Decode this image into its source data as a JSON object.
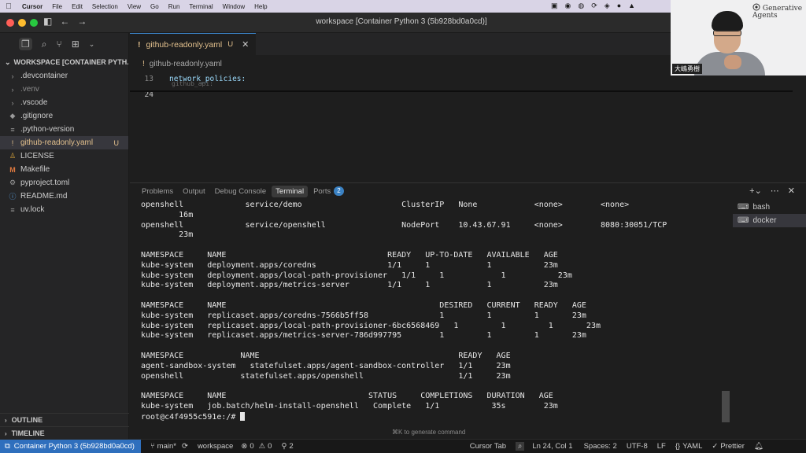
{
  "menubar": {
    "items": [
      "Cursor",
      "File",
      "Edit",
      "Selection",
      "View",
      "Go",
      "Run",
      "Terminal",
      "Window",
      "Help"
    ]
  },
  "window": {
    "title": "workspace [Container Python 3 (5b928bd0a0cd)]"
  },
  "sidebar": {
    "header": "WORKSPACE [CONTAINER PYTH...",
    "items": [
      {
        "label": ".devcontainer",
        "icon": "chevron-right-icon"
      },
      {
        "label": ".venv",
        "icon": "chevron-right-icon"
      },
      {
        "label": ".vscode",
        "icon": "chevron-right-icon"
      },
      {
        "label": ".gitignore",
        "icon": "git-icon"
      },
      {
        "label": ".python-version",
        "icon": "lines-icon"
      },
      {
        "label": "github-readonly.yaml",
        "icon": "exclamation-icon",
        "badge": "U"
      },
      {
        "label": "LICENSE",
        "icon": "license-icon"
      },
      {
        "label": "Makefile",
        "icon": "makefile-icon"
      },
      {
        "label": "pyproject.toml",
        "icon": "gear-icon"
      },
      {
        "label": "README.md",
        "icon": "info-icon"
      },
      {
        "label": "uv.lock",
        "icon": "lines-icon"
      }
    ],
    "outline": "OUTLINE",
    "timeline": "TIMELINE"
  },
  "editor": {
    "tab": {
      "label": "github-readonly.yaml",
      "status": "U"
    },
    "breadcrumb": "github-readonly.yaml",
    "lines": [
      {
        "number": "13",
        "text": "network_policies:"
      },
      {
        "number": "24",
        "text": ""
      }
    ],
    "ghost_text": "github_api:"
  },
  "panel": {
    "tabs": [
      "Problems",
      "Output",
      "Debug Console",
      "Terminal",
      "Ports"
    ],
    "ports_count": "2",
    "terminal_lines": [
      "openshell             service/demo                     ClusterIP   None            <none>        <none>",
      "        16m",
      "openshell             service/openshell                NodePort    10.43.67.91     <none>        8080:30051/TCP",
      "        23m",
      "",
      "NAMESPACE     NAME                                  READY   UP-TO-DATE   AVAILABLE   AGE",
      "kube-system   deployment.apps/coredns               1/1     1            1           23m",
      "kube-system   deployment.apps/local-path-provisioner   1/1     1            1           23m",
      "kube-system   deployment.apps/metrics-server        1/1     1            1           23m",
      "",
      "NAMESPACE     NAME                                             DESIRED   CURRENT   READY   AGE",
      "kube-system   replicaset.apps/coredns-7566b5ff58               1         1         1       23m",
      "kube-system   replicaset.apps/local-path-provisioner-6bc6568469   1         1         1       23m",
      "kube-system   replicaset.apps/metrics-server-786d997795        1         1         1       23m",
      "",
      "NAMESPACE            NAME                                          READY   AGE",
      "agent-sandbox-system   statefulset.apps/agent-sandbox-controller   1/1     23m",
      "openshell            statefulset.apps/openshell                    1/1     23m",
      "",
      "NAMESPACE     NAME                              STATUS     COMPLETIONS   DURATION   AGE",
      "kube-system   job.batch/helm-install-openshell   Complete   1/1           35s        23m"
    ],
    "prompt": "root@c4f4955c591e:/# ",
    "hint": "⌘K to generate command",
    "shells": [
      "bash",
      "docker"
    ]
  },
  "statusbar": {
    "remote": "Container Python 3 (5b928bd0a0cd)",
    "branch": "main*",
    "workspace": "workspace",
    "errors": "0",
    "warnings": "0",
    "ports": "2",
    "cursor_tab": "Cursor Tab",
    "position": "Ln 24, Col 1",
    "spaces": "Spaces: 2",
    "encoding": "UTF-8",
    "eol": "LF",
    "language": "YAML",
    "formatter": "Prettier"
  },
  "webcam": {
    "name": "大嶋勇樹",
    "logo": "Generative Agents"
  }
}
